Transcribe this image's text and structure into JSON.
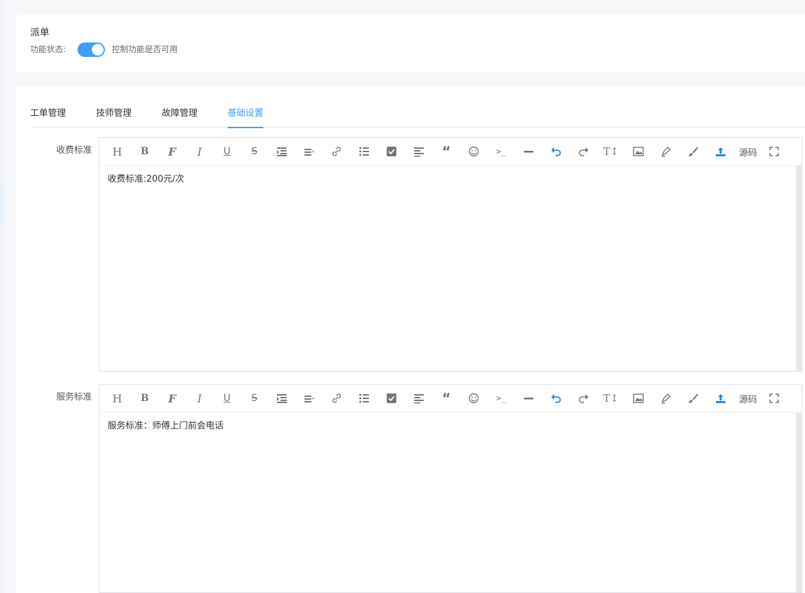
{
  "header": {
    "title": "派单",
    "status_label": "功能状态:",
    "switch_on": true,
    "hint": "控制功能是否可用"
  },
  "tabs": [
    {
      "label": "工单管理",
      "active": false
    },
    {
      "label": "技师管理",
      "active": false
    },
    {
      "label": "故障管理",
      "active": false
    },
    {
      "label": "基础设置",
      "active": true
    }
  ],
  "toolbar": {
    "icons": [
      "heading-icon",
      "bold-icon",
      "font-icon",
      "italic-icon",
      "underline-icon",
      "strikethrough-icon",
      "indent-icon",
      "line-height-icon",
      "link-icon",
      "unordered-list-icon",
      "checkbox-icon",
      "align-left-icon",
      "quote-icon",
      "emoji-icon",
      "code-icon",
      "horizontal-rule-icon",
      "undo-icon",
      "redo-icon",
      "font-size-icon",
      "image-icon",
      "highlight-icon",
      "paint-brush-icon",
      "upload-icon"
    ],
    "source_label": "源码",
    "fullscreen_icon": "fullscreen-icon"
  },
  "fields": [
    {
      "label": "收费标准",
      "content": "收费标准:200元/次"
    },
    {
      "label": "服务标准",
      "content": "服务标准：师傅上门前会电话"
    }
  ],
  "colors": {
    "accent": "#409eff",
    "toolbar_blue": "#1e88e5",
    "icon_gray": "#757575"
  }
}
